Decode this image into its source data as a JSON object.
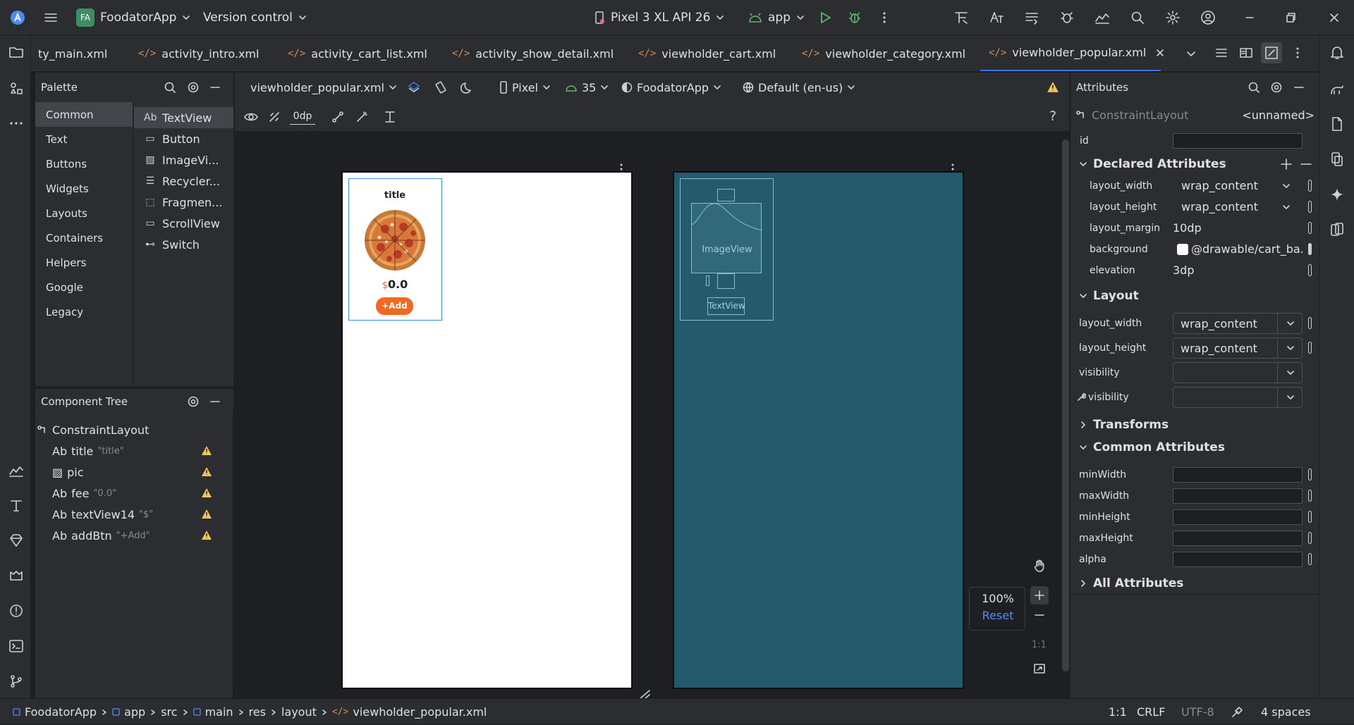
{
  "titlebar": {
    "project_initials": "FA",
    "project_name": "FoodatorApp",
    "version_control": "Version control",
    "device": "Pixel 3 XL API 26",
    "run_config": "app"
  },
  "tabs": [
    {
      "label": "ty_main.xml"
    },
    {
      "label": "activity_intro.xml"
    },
    {
      "label": "activity_cart_list.xml"
    },
    {
      "label": "activity_show_detail.xml"
    },
    {
      "label": "viewholder_cart.xml"
    },
    {
      "label": "viewholder_category.xml"
    },
    {
      "label": "viewholder_popular.xml",
      "active": true
    }
  ],
  "palette": {
    "title": "Palette",
    "categories": [
      "Common",
      "Text",
      "Buttons",
      "Widgets",
      "Layouts",
      "Containers",
      "Helpers",
      "Google",
      "Legacy"
    ],
    "widgets": [
      {
        "icon": "Ab",
        "label": "TextView"
      },
      {
        "icon": "▭",
        "label": "Button"
      },
      {
        "icon": "▨",
        "label": "ImageVi..."
      },
      {
        "icon": "☰",
        "label": "Recycler..."
      },
      {
        "icon": "⬚",
        "label": "Fragmen..."
      },
      {
        "icon": "▭",
        "label": "ScrollView"
      },
      {
        "icon": "⊷",
        "label": "Switch"
      }
    ]
  },
  "component_tree": {
    "title": "Component Tree",
    "root": "ConstraintLayout",
    "items": [
      {
        "icon": "Ab",
        "name": "title",
        "sub": "\"title\""
      },
      {
        "icon": "▨",
        "name": "pic",
        "sub": ""
      },
      {
        "icon": "Ab",
        "name": "fee",
        "sub": "\"0.0\""
      },
      {
        "icon": "Ab",
        "name": "textView14",
        "sub": "\"$\""
      },
      {
        "icon": "Ab",
        "name": "addBtn",
        "sub": "\"+Add\""
      }
    ]
  },
  "editor_toolbar": {
    "file": "viewholder_popular.xml",
    "device": "Pixel",
    "api": "35",
    "theme": "FoodatorApp",
    "locale": "Default (en-us)",
    "margin": "0dp",
    "help": "?"
  },
  "design_preview": {
    "title": "title",
    "currency": "$",
    "fee": "0.0",
    "add_button": "+Add",
    "accent": "#f26722"
  },
  "blueprint": {
    "image_label": "ImageView",
    "text_label": "TextView",
    "bg": "#245a6c"
  },
  "zoom": {
    "level": "100%",
    "reset": "Reset",
    "ratio": "1:1"
  },
  "attributes": {
    "title": "Attributes",
    "class": "ConstraintLayout",
    "unnamed": "<unnamed>",
    "id_label": "id",
    "declared_title": "Declared Attributes",
    "declared": [
      {
        "name": "layout_width",
        "value": "wrap_content",
        "dropdown": true
      },
      {
        "name": "layout_height",
        "value": "wrap_content",
        "dropdown": true
      },
      {
        "name": "layout_margin",
        "value": "10dp"
      },
      {
        "name": "background",
        "value": "@drawable/cart_ba..."
      },
      {
        "name": "elevation",
        "value": "3dp"
      }
    ],
    "layout_title": "Layout",
    "layout": [
      {
        "name": "layout_width",
        "value": "wrap_content"
      },
      {
        "name": "layout_height",
        "value": "wrap_content"
      },
      {
        "name": "visibility",
        "value": ""
      },
      {
        "name": "visibility",
        "value": "",
        "tools": true
      }
    ],
    "transforms_title": "Transforms",
    "common_title": "Common Attributes",
    "common": [
      "minWidth",
      "maxWidth",
      "minHeight",
      "maxHeight",
      "alpha"
    ],
    "all_title": "All Attributes"
  },
  "statusbar": {
    "breadcrumb": [
      "FoodatorApp",
      "app",
      "src",
      "main",
      "res",
      "layout",
      "viewholder_popular.xml"
    ],
    "position": "1:1",
    "line_sep": "CRLF",
    "encoding": "UTF-8",
    "indent": "4 spaces"
  }
}
